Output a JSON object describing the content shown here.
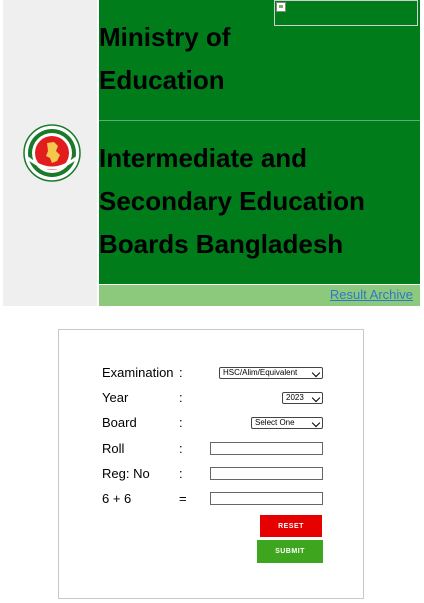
{
  "header": {
    "title_line1": "Ministry of",
    "title_line2": "Education",
    "board_line1": "Intermediate and",
    "board_line2": "Secondary Education",
    "board_line3": "Boards Bangladesh",
    "archive_link": "Result Archive"
  },
  "form": {
    "examination_label": "Examination",
    "year_label": "Year",
    "board_label": "Board",
    "roll_label": "Roll",
    "reg_label": "Reg: No",
    "captcha_question": "6 + 6",
    "colon": ":",
    "equals": "=",
    "examination_value": "HSC/Alim/Equivalent",
    "year_value": "2023",
    "board_value": "Select One",
    "roll_value": "",
    "reg_value": "",
    "captcha_value": "",
    "reset_label": "RESET",
    "submit_label": "SUBMIT"
  },
  "colors": {
    "header_green": "#007c1a",
    "archive_bar": "#8dc97c",
    "reset_red": "#e60000",
    "submit_green": "#3ea51f"
  },
  "icons": {
    "seal": "government-seal-icon",
    "broken_image": "broken-image-icon",
    "dropdown": "chevron-down-icon"
  }
}
